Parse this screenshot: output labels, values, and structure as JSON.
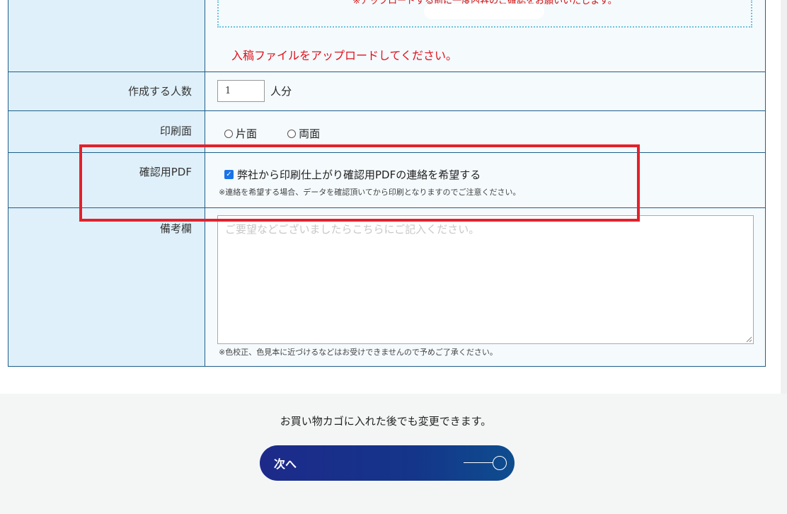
{
  "upload": {
    "note": "※アップロードする前に一度内容のご確認をお願いいたします。",
    "error": "入稿ファイルをアップロードしてください。"
  },
  "rows": {
    "count": {
      "label": "作成する人数",
      "value": "1",
      "suffix": "人分"
    },
    "print_side": {
      "label": "印刷面",
      "options": [
        "片面",
        "両面"
      ]
    },
    "pdf": {
      "label": "確認用PDF",
      "checkbox_label": "弊社から印刷仕上がり確認用PDFの連絡を希望する",
      "checked": true,
      "note": "※連絡を希望する場合、データを確認頂いてから印刷となりますのでご注意ください。"
    },
    "remarks": {
      "label": "備考欄",
      "placeholder": "ご要望などございましたらこちらにご記入ください。",
      "note": "※色校正、色見本に近づけるなどはお受けできませんので予めご了承ください。"
    }
  },
  "footer": {
    "note": "お買い物カゴに入れた後でも変更できます。",
    "next_label": "次へ"
  },
  "colors": {
    "label_bg": "#dff0fa",
    "border": "#1f5f8b",
    "error_red": "#e0101a",
    "highlight_box": "#e3212b",
    "button_start": "#1d2a8a",
    "button_end": "#0e4d8e"
  }
}
